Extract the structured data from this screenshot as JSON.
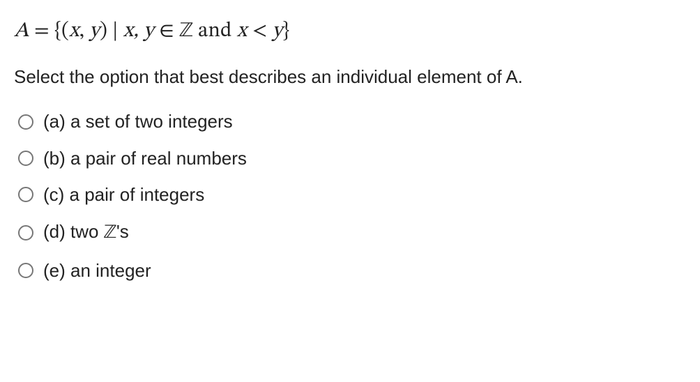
{
  "formula": {
    "lhs_var": "A",
    "eq": " = ",
    "open": "{(",
    "x": "x",
    "comma1": ", ",
    "y": "y",
    "close_paren": ")",
    "bar": "  |  ",
    "xy": "x, y",
    "elem": " ∈ ",
    "Z": "ℤ",
    "and": " and ",
    "x2": "x",
    "lt": " < ",
    "y2": "y",
    "close_brace": "}"
  },
  "prompt": "Select the option that best describes an individual element of A.",
  "options": [
    {
      "label": "(a) a set of two integers"
    },
    {
      "label": "(b) a pair of real numbers"
    },
    {
      "label": "(c) a pair of integers"
    },
    {
      "label_prefix": "(d) two ",
      "bb": "ℤ",
      "label_suffix": "'s"
    },
    {
      "label": "(e) an integer"
    }
  ]
}
